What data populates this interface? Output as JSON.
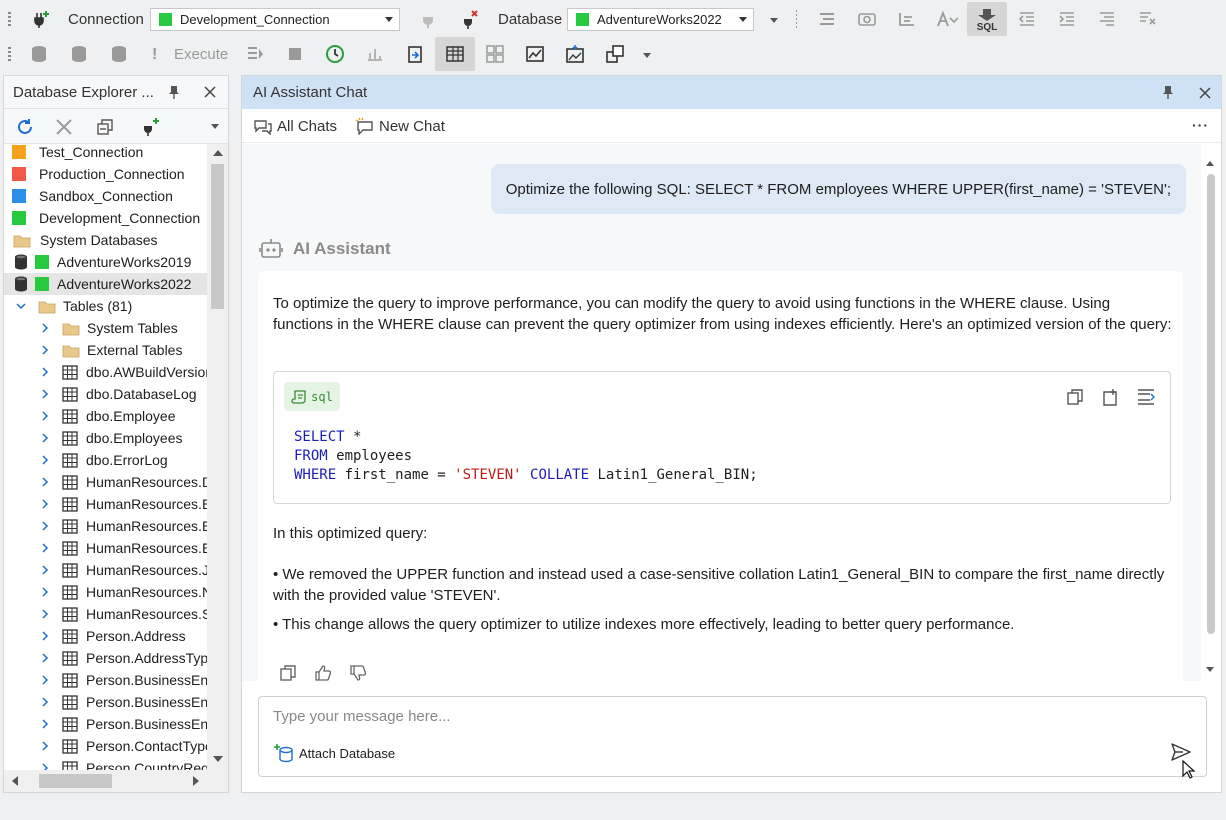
{
  "toolbar1": {
    "connection_label": "Connection",
    "connection_value": "Development_Connection",
    "database_label": "Database",
    "database_value": "AdventureWorks2022",
    "sql_label": "SQL"
  },
  "toolbar2": {
    "execute_label": "Execute"
  },
  "explorer": {
    "title": "Database Explorer ...",
    "items": [
      {
        "label": "Test_Connection",
        "color": "#f5a31a",
        "kind": "conn"
      },
      {
        "label": "Production_Connection",
        "color": "#f0584a",
        "kind": "conn"
      },
      {
        "label": "Sandbox_Connection",
        "color": "#2a8fe8",
        "kind": "conn"
      },
      {
        "label": "Development_Connection",
        "color": "#27c93f",
        "kind": "conn"
      },
      {
        "label": "System Databases",
        "kind": "folder"
      },
      {
        "label": "AdventureWorks2019",
        "color": "#27c93f",
        "kind": "db"
      },
      {
        "label": "AdventureWorks2022",
        "color": "#27c93f",
        "kind": "db",
        "selected": true
      },
      {
        "label": "Tables (81)",
        "kind": "tables"
      },
      {
        "label": "System Tables",
        "kind": "subfolder"
      },
      {
        "label": "External Tables",
        "kind": "subfolder"
      },
      {
        "label": "dbo.AWBuildVersion",
        "kind": "table"
      },
      {
        "label": "dbo.DatabaseLog",
        "kind": "table"
      },
      {
        "label": "dbo.Employee",
        "kind": "table"
      },
      {
        "label": "dbo.Employees",
        "kind": "table"
      },
      {
        "label": "dbo.ErrorLog",
        "kind": "table"
      },
      {
        "label": "HumanResources.De",
        "kind": "table"
      },
      {
        "label": "HumanResources.Er",
        "kind": "table"
      },
      {
        "label": "HumanResources.Er",
        "kind": "table"
      },
      {
        "label": "HumanResources.Er",
        "kind": "table"
      },
      {
        "label": "HumanResources.Jc",
        "kind": "table"
      },
      {
        "label": "HumanResources.Nc",
        "kind": "table"
      },
      {
        "label": "HumanResources.Sh",
        "kind": "table"
      },
      {
        "label": "Person.Address",
        "kind": "table"
      },
      {
        "label": "Person.AddressType",
        "kind": "table"
      },
      {
        "label": "Person.BusinessEntit",
        "kind": "table"
      },
      {
        "label": "Person.BusinessEntit",
        "kind": "table"
      },
      {
        "label": "Person.BusinessEntit",
        "kind": "table"
      },
      {
        "label": "Person.ContactType",
        "kind": "table"
      },
      {
        "label": "Person.CountryRegi",
        "kind": "table"
      }
    ]
  },
  "chat": {
    "title": "AI Assistant Chat",
    "all_chats_label": "All Chats",
    "new_chat_label": "New Chat",
    "user_message": "Optimize the following SQL: SELECT * FROM employees WHERE UPPER(first_name) = 'STEVEN';",
    "assistant_name": "AI Assistant",
    "intro": "To optimize the query to improve performance, you can modify the query to avoid using functions in the WHERE clause. Using functions in the WHERE clause can prevent the query optimizer from using indexes efficiently. Here's an optimized version of the query:",
    "code_lang": "sql",
    "code": {
      "l1_kw": "SELECT",
      "l1_rest": " *",
      "l2_kw": "FROM",
      "l2_rest": " employees",
      "l3_kw": "WHERE",
      "l3_a": " first_name = ",
      "l3_str": "'STEVEN'",
      "l3_kw2": " COLLATE",
      "l3_b": " Latin1_General_BIN;"
    },
    "explain_heading": "In this optimized query:",
    "bullet1": "• We removed the UPPER function and instead used a case-sensitive collation Latin1_General_BIN to compare the first_name directly with the provided value 'STEVEN'.",
    "bullet2": "• This change allows the query optimizer to utilize indexes more effectively, leading to better query performance.",
    "input_placeholder": "Type your message here...",
    "attach_label": "Attach Database"
  }
}
